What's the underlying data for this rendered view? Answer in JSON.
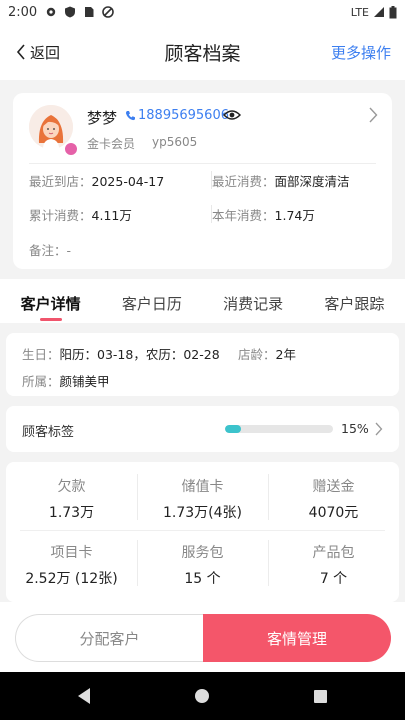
{
  "status_bar": {
    "time": "2:00",
    "network": "LTE"
  },
  "header": {
    "back_label": "返回",
    "title": "顾客档案",
    "more_label": "更多操作"
  },
  "customer": {
    "name": "梦梦",
    "phone": "18895695606",
    "level": "金卡会员",
    "code": "yp5605",
    "last_visit_label": "最近到店：",
    "last_visit_value": "2025-04-17",
    "last_spend_label": "最近消费：",
    "last_spend_value": "面部深度清洁",
    "total_spend_label": "累计消费：",
    "total_spend_value": "4.11万",
    "year_spend_label": "本年消费：",
    "year_spend_value": "1.74万",
    "note_label": "备注：",
    "note_value": "-"
  },
  "tabs": [
    {
      "label": "客户详情",
      "active": true
    },
    {
      "label": "客户日历",
      "active": false
    },
    {
      "label": "消费记录",
      "active": false
    },
    {
      "label": "客户跟踪",
      "active": false
    }
  ],
  "detail": {
    "birthday_label": "生日：",
    "birthday_value": "阳历：03-18，农历：02-28",
    "store_age_label": "店龄：",
    "store_age_value": "2年",
    "belong_label": "所属：",
    "belong_value": "颜铺美甲"
  },
  "tags": {
    "label": "顾客标签",
    "percent": 15,
    "percent_text": "15%"
  },
  "stats": [
    {
      "title": "欠款",
      "value": "1.73万"
    },
    {
      "title": "储值卡",
      "value": "1.73万(4张)"
    },
    {
      "title": "赠送金",
      "value": "4070元"
    },
    {
      "title": "项目卡",
      "value": "2.52万 (12张)"
    },
    {
      "title": "服务包",
      "value": "15 个"
    },
    {
      "title": "产品包",
      "value": "7 个"
    }
  ],
  "actions": {
    "assign_label": "分配客户",
    "manage_label": "客情管理"
  },
  "colors": {
    "accent": "#f4566a",
    "link": "#3d7ff0",
    "progress": "#3cc3cc"
  },
  "icons": [
    "gear-icon",
    "shield-icon",
    "sim-icon",
    "no-disturb-icon",
    "signal-icon",
    "battery-icon",
    "chevron-left-icon",
    "phone-icon",
    "eye-icon",
    "chevron-right-icon",
    "back-triangle-icon",
    "home-circle-icon",
    "recents-square-icon"
  ]
}
